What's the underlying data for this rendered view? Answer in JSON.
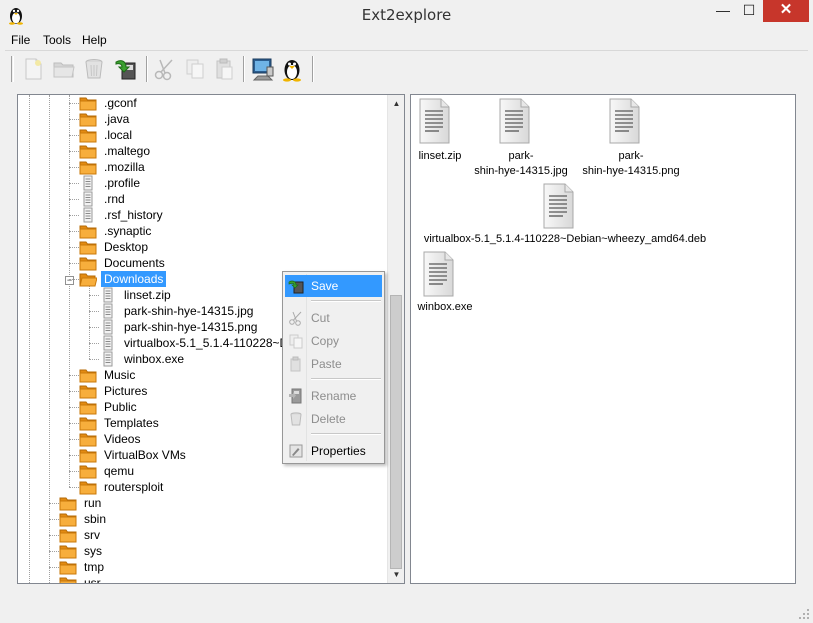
{
  "window": {
    "title": "Ext2explore",
    "minimize_glyph": "—",
    "maximize_glyph": "☐",
    "close_glyph": "✕"
  },
  "menu": {
    "items": [
      {
        "label": "File"
      },
      {
        "label": "Tools"
      },
      {
        "label": "Help"
      }
    ]
  },
  "toolbar": {
    "buttons": [
      {
        "icon": "new-file-icon",
        "enabled": false
      },
      {
        "icon": "folder-icon",
        "enabled": false
      },
      {
        "icon": "trash-icon",
        "enabled": false
      },
      {
        "icon": "save-icon",
        "enabled": true
      },
      {
        "icon": "cut-icon",
        "enabled": false
      },
      {
        "icon": "copy-icon",
        "enabled": false
      },
      {
        "icon": "paste-icon",
        "enabled": false
      },
      {
        "icon": "computer-icon",
        "enabled": true
      },
      {
        "icon": "linux-penguin-icon",
        "enabled": true
      }
    ]
  },
  "tree": {
    "nodes": [
      {
        "label": ".gconf",
        "icon": "folder-icon"
      },
      {
        "label": ".java",
        "icon": "folder-icon"
      },
      {
        "label": ".local",
        "icon": "folder-icon"
      },
      {
        "label": ".maltego",
        "icon": "folder-icon"
      },
      {
        "label": ".mozilla",
        "icon": "folder-icon"
      },
      {
        "label": ".profile",
        "icon": "file-icon"
      },
      {
        "label": ".rnd",
        "icon": "file-icon"
      },
      {
        "label": ".rsf_history",
        "icon": "file-icon"
      },
      {
        "label": ".synaptic",
        "icon": "folder-icon"
      },
      {
        "label": "Desktop",
        "icon": "folder-icon"
      },
      {
        "label": "Documents",
        "icon": "folder-icon"
      },
      {
        "label": "Downloads",
        "icon": "folder-open-icon",
        "selected": true,
        "expanded": true
      },
      {
        "label": "linset.zip",
        "icon": "file-icon"
      },
      {
        "label": "park-shin-hye-14315.jpg",
        "icon": "file-icon"
      },
      {
        "label": "park-shin-hye-14315.png",
        "icon": "file-icon"
      },
      {
        "label": "virtualbox-5.1_5.1.4-110228~D",
        "icon": "file-icon"
      },
      {
        "label": "winbox.exe",
        "icon": "file-icon"
      },
      {
        "label": "Music",
        "icon": "folder-icon"
      },
      {
        "label": "Pictures",
        "icon": "folder-icon"
      },
      {
        "label": "Public",
        "icon": "folder-icon"
      },
      {
        "label": "Templates",
        "icon": "folder-icon"
      },
      {
        "label": "Videos",
        "icon": "folder-icon"
      },
      {
        "label": "VirtualBox VMs",
        "icon": "folder-icon"
      },
      {
        "label": "qemu",
        "icon": "folder-icon"
      },
      {
        "label": "routersploit",
        "icon": "folder-icon"
      },
      {
        "label": "run",
        "icon": "folder-icon"
      },
      {
        "label": "sbin",
        "icon": "folder-icon"
      },
      {
        "label": "srv",
        "icon": "folder-icon"
      },
      {
        "label": "sys",
        "icon": "folder-icon"
      },
      {
        "label": "tmp",
        "icon": "folder-icon"
      },
      {
        "label": "usr",
        "icon": "folder-icon"
      }
    ],
    "scroll_up_glyph": "▲",
    "scroll_down_glyph": "▼",
    "collapse_glyph": "−"
  },
  "files": [
    {
      "name": "linset.zip",
      "icon": "document-icon"
    },
    {
      "name": "park-\nshin-hye-14315.jpg",
      "icon": "document-icon"
    },
    {
      "name": "park-\nshin-hye-14315.png",
      "icon": "document-icon"
    },
    {
      "name": "virtualbox-5.1_5.1.4-110228~Debian~wheezy_amd64.deb",
      "icon": "document-icon"
    },
    {
      "name": "winbox.exe",
      "icon": "document-icon"
    }
  ],
  "context_menu": {
    "items": [
      {
        "label": "Save",
        "icon": "save-icon",
        "enabled": true,
        "highlighted": true
      },
      {
        "label": "Cut",
        "icon": "cut-icon",
        "enabled": false
      },
      {
        "label": "Copy",
        "icon": "copy-icon",
        "enabled": false
      },
      {
        "label": "Paste",
        "icon": "paste-icon",
        "enabled": false
      },
      {
        "label": "Rename",
        "icon": "rename-icon",
        "enabled": false
      },
      {
        "label": "Delete",
        "icon": "trash-icon",
        "enabled": false
      },
      {
        "label": "Properties",
        "icon": "properties-icon",
        "enabled": true
      }
    ]
  },
  "colors": {
    "selection": "#3399ff",
    "close_button": "#c7362b",
    "folder": "#f5a623"
  }
}
